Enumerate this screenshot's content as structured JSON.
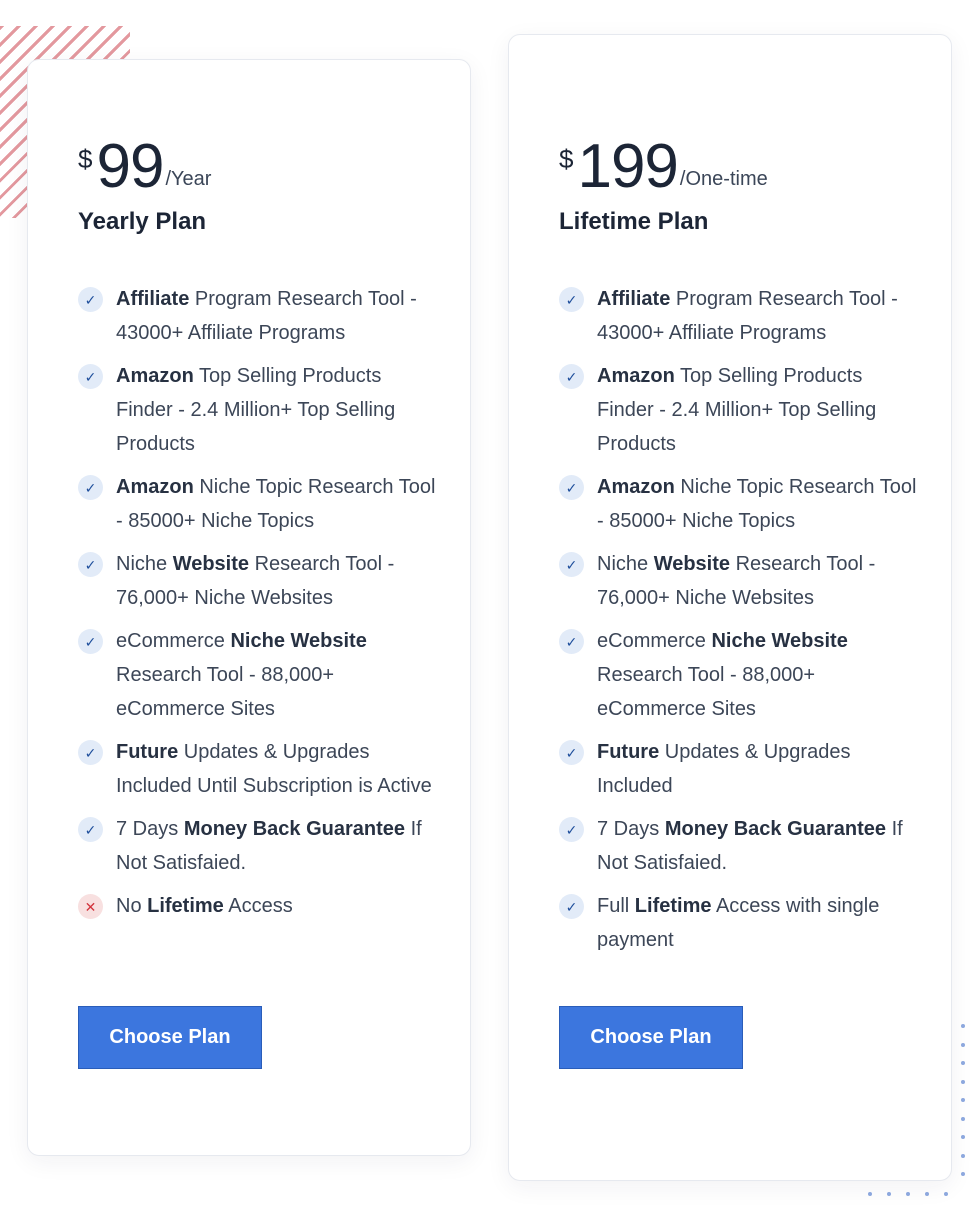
{
  "plans": [
    {
      "currency": "$",
      "amount": "99",
      "period": "/Year",
      "name": "Yearly Plan",
      "features": [
        {
          "included": true,
          "parts": [
            {
              "t": "Affiliate",
              "b": true
            },
            {
              "t": " Program Research Tool - 43000+ Affiliate Programs",
              "b": false
            }
          ]
        },
        {
          "included": true,
          "parts": [
            {
              "t": "Amazon",
              "b": true
            },
            {
              "t": " Top Selling Products Finder - 2.4 Million+ Top Selling Products",
              "b": false
            }
          ]
        },
        {
          "included": true,
          "parts": [
            {
              "t": "Amazon",
              "b": true
            },
            {
              "t": " Niche Topic Research Tool - 85000+ Niche Topics",
              "b": false
            }
          ]
        },
        {
          "included": true,
          "parts": [
            {
              "t": "Niche ",
              "b": false
            },
            {
              "t": "Website",
              "b": true
            },
            {
              "t": " Research Tool - 76,000+ Niche Websites",
              "b": false
            }
          ]
        },
        {
          "included": true,
          "parts": [
            {
              "t": "eCommerce ",
              "b": false
            },
            {
              "t": "Niche Website",
              "b": true
            },
            {
              "t": " Research Tool - 88,000+ eCommerce Sites",
              "b": false
            }
          ]
        },
        {
          "included": true,
          "parts": [
            {
              "t": "Future",
              "b": true
            },
            {
              "t": " Updates & Upgrades Included Until Subscription is Active",
              "b": false
            }
          ]
        },
        {
          "included": true,
          "parts": [
            {
              "t": "7 Days ",
              "b": false
            },
            {
              "t": "Money Back Guarantee",
              "b": true
            },
            {
              "t": " If Not Satisfaied.",
              "b": false
            }
          ]
        },
        {
          "included": false,
          "parts": [
            {
              "t": "No ",
              "b": false
            },
            {
              "t": "Lifetime",
              "b": true
            },
            {
              "t": " Access",
              "b": false
            }
          ]
        }
      ],
      "button_label": "Choose Plan"
    },
    {
      "currency": "$",
      "amount": "199",
      "period": "/One-time",
      "name": "Lifetime Plan",
      "features": [
        {
          "included": true,
          "parts": [
            {
              "t": "Affiliate",
              "b": true
            },
            {
              "t": " Program Research Tool - 43000+ Affiliate Programs",
              "b": false
            }
          ]
        },
        {
          "included": true,
          "parts": [
            {
              "t": "Amazon",
              "b": true
            },
            {
              "t": " Top Selling Products Finder - 2.4 Million+ Top Selling Products",
              "b": false
            }
          ]
        },
        {
          "included": true,
          "parts": [
            {
              "t": "Amazon",
              "b": true
            },
            {
              "t": " Niche Topic Research Tool - 85000+ Niche Topics",
              "b": false
            }
          ]
        },
        {
          "included": true,
          "parts": [
            {
              "t": "Niche ",
              "b": false
            },
            {
              "t": "Website",
              "b": true
            },
            {
              "t": " Research Tool - 76,000+ Niche Websites",
              "b": false
            }
          ]
        },
        {
          "included": true,
          "parts": [
            {
              "t": "eCommerce ",
              "b": false
            },
            {
              "t": "Niche Website",
              "b": true
            },
            {
              "t": " Research Tool - 88,000+ eCommerce Sites",
              "b": false
            }
          ]
        },
        {
          "included": true,
          "parts": [
            {
              "t": "Future",
              "b": true
            },
            {
              "t": " Updates & Upgrades Included",
              "b": false
            }
          ]
        },
        {
          "included": true,
          "parts": [
            {
              "t": "7 Days ",
              "b": false
            },
            {
              "t": "Money Back Guarantee",
              "b": true
            },
            {
              "t": " If Not Satisfaied.",
              "b": false
            }
          ]
        },
        {
          "included": true,
          "parts": [
            {
              "t": "Full ",
              "b": false
            },
            {
              "t": "Lifetime",
              "b": true
            },
            {
              "t": " Access with single payment",
              "b": false
            }
          ]
        }
      ],
      "button_label": "Choose Plan"
    }
  ],
  "icons": {
    "included": "check-icon",
    "excluded": "cross-icon"
  },
  "colors": {
    "button": "#3c76de",
    "check_bg": "#e2ebf8",
    "cross": "#d2343d",
    "decor_stripes": "#da767e",
    "decor_dots": "#8faae0"
  }
}
